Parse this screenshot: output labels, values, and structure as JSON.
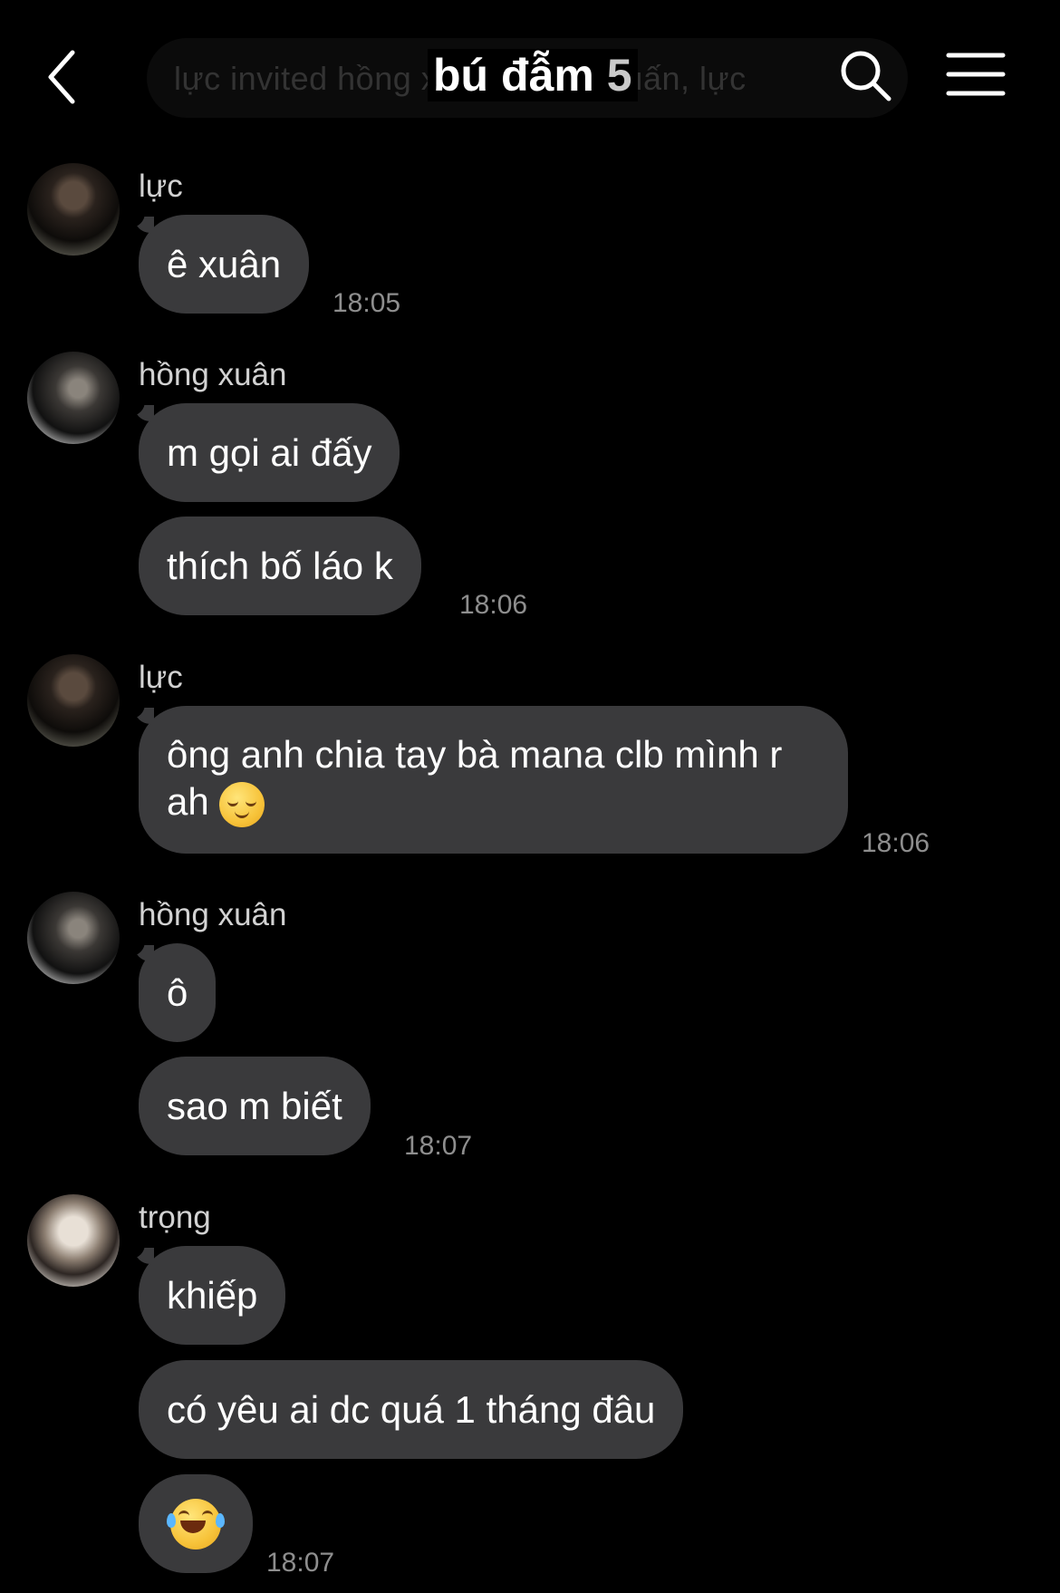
{
  "header": {
    "banner_text": "lực invited hồng xuân, thành huấn, lực",
    "title_name": "bú đẫm",
    "title_count": "5"
  },
  "messages": [
    {
      "sender": "lực",
      "avatar": "avatar-luc",
      "bubbles": [
        "ê xuân"
      ],
      "time": "18:05"
    },
    {
      "sender": "hồng xuân",
      "avatar": "avatar-hong-xuan",
      "bubbles": [
        "m gọi ai đấy",
        "thích bố láo k"
      ],
      "time": "18:06"
    },
    {
      "sender": "lực",
      "avatar": "avatar-luc",
      "bubbles": [
        "ông anh chia tay bà mana clb mình r ah"
      ],
      "emoji": "relieved-face",
      "time": "18:06"
    },
    {
      "sender": "hồng xuân",
      "avatar": "avatar-hong-xuan",
      "bubbles": [
        "ô",
        "sao m biết"
      ],
      "time": "18:07"
    },
    {
      "sender": "trọng",
      "avatar": "avatar-trong",
      "bubbles": [
        "khiếp",
        "có yêu ai dc quá 1 tháng đâu"
      ],
      "emoji": "face-with-tears-of-joy",
      "time": "18:07"
    }
  ]
}
